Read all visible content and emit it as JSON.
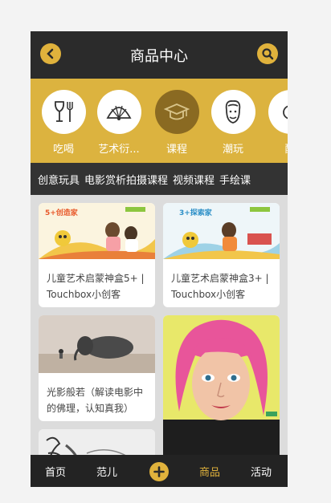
{
  "header": {
    "title": "商品中心",
    "back_icon": "chevron-left-icon",
    "search_icon": "search-icon"
  },
  "categories": [
    {
      "label": "吃喝",
      "icon": "wineglass-fork-icon"
    },
    {
      "label": "艺术衍...",
      "icon": "fan-icon"
    },
    {
      "label": "课程",
      "icon": "graduation-cap-icon",
      "active": true
    },
    {
      "label": "潮玩",
      "icon": "face-icon"
    },
    {
      "label": "配",
      "icon": "partial-icon"
    }
  ],
  "subnav": [
    "创意玩具",
    "电影赏析拍摄课程",
    "视频课程",
    "手绘课"
  ],
  "cards": [
    {
      "title": "儿童艺术启蒙神盒5+ | Touchbox小创客",
      "badge": "5+创造家"
    },
    {
      "title": "儿童艺术启蒙神盒3+ | Touchbox小创客",
      "badge": "3+探索家"
    },
    {
      "title": "光影般若（解读电影中的佛理，认知真我）"
    }
  ],
  "tabs": [
    {
      "label": "首页"
    },
    {
      "label": "范儿"
    },
    {
      "label": "商品",
      "active": true
    },
    {
      "label": "活动"
    }
  ],
  "colors": {
    "accent": "#e0b23c",
    "header_bg": "#2b2b2b",
    "category_bg": "#dcb33f"
  }
}
